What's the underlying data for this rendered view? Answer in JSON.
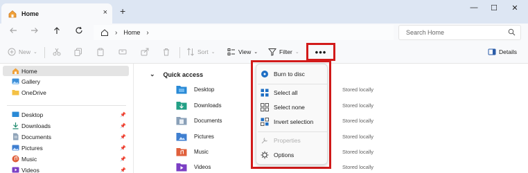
{
  "window": {
    "tab_title": "Home",
    "new_tab_symbol": "+",
    "close_tab_symbol": "×",
    "minimize_symbol": "—",
    "maximize_symbol": "☐",
    "close_symbol": "✕"
  },
  "address": {
    "crumbs": [
      "Home"
    ],
    "search_placeholder": "Search Home"
  },
  "commands": {
    "new": "New",
    "sort": "Sort",
    "view": "View",
    "filter": "Filter",
    "see_more": "•••",
    "details": "Details"
  },
  "sidebar": {
    "items": [
      {
        "label": "Home",
        "icon": "home-icon"
      },
      {
        "label": "Gallery",
        "icon": "gallery-icon"
      },
      {
        "label": "OneDrive",
        "icon": "onedrive-icon"
      },
      {
        "label": "Desktop",
        "icon": "desktop-icon"
      },
      {
        "label": "Downloads",
        "icon": "downloads-icon"
      },
      {
        "label": "Documents",
        "icon": "documents-icon"
      },
      {
        "label": "Pictures",
        "icon": "pictures-icon"
      },
      {
        "label": "Music",
        "icon": "music-icon"
      },
      {
        "label": "Videos",
        "icon": "videos-icon"
      }
    ]
  },
  "main": {
    "section_title": "Quick access",
    "rows": [
      {
        "name": "Desktop",
        "status": "Stored locally"
      },
      {
        "name": "Downloads",
        "status": "Stored locally"
      },
      {
        "name": "Documents",
        "status": "Stored locally"
      },
      {
        "name": "Pictures",
        "status": "Stored locally"
      },
      {
        "name": "Music",
        "status": "Stored locally"
      },
      {
        "name": "Videos",
        "status": "Stored locally"
      }
    ]
  },
  "menu": {
    "items": [
      {
        "label": "Burn to disc",
        "icon": "burn-disc-icon",
        "enabled": true
      },
      {
        "label": "Select all",
        "icon": "select-all-icon",
        "enabled": true
      },
      {
        "label": "Select none",
        "icon": "select-none-icon",
        "enabled": true
      },
      {
        "label": "Invert selection",
        "icon": "invert-selection-icon",
        "enabled": true
      },
      {
        "label": "Properties",
        "icon": "properties-icon",
        "enabled": false
      },
      {
        "label": "Options",
        "icon": "options-icon",
        "enabled": true
      }
    ]
  },
  "colors": {
    "highlight": "#d21a1a",
    "titlebar": "#dde6f3",
    "folder_yellow": "#f4c145"
  }
}
